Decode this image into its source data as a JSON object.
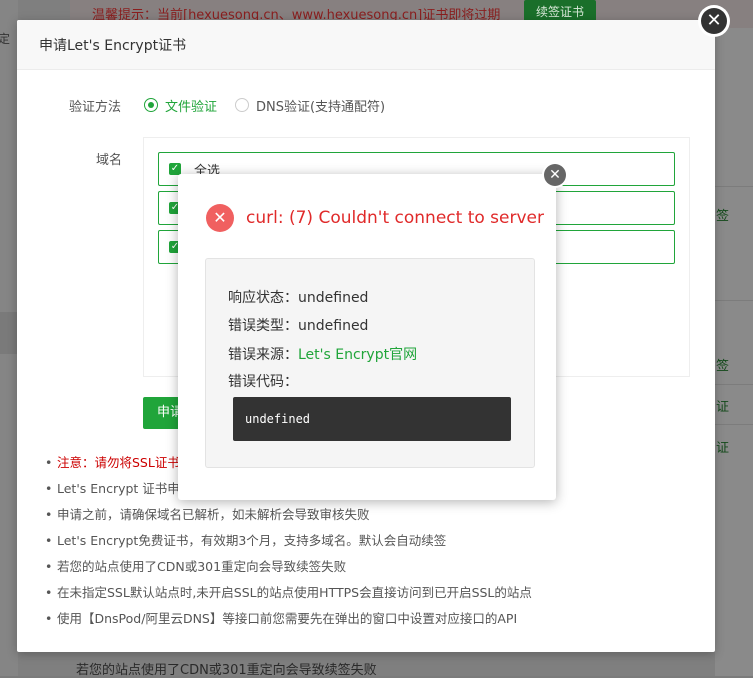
{
  "background": {
    "left_text": "定",
    "warning_text": "温馨提示：当前[hexuesong.cn、www.hexuesong.cn]证书即将过期",
    "renew_button": "续签证书",
    "right_items": [
      "签",
      "签",
      "证",
      "证"
    ],
    "bottom_note": "若您的站点使用了CDN或301重定向会导致续签失败"
  },
  "dialog": {
    "title": "申请Let's Encrypt证书",
    "verify_label": "验证方法",
    "verify_options": [
      {
        "label": "文件验证",
        "selected": true
      },
      {
        "label": "DNS验证(支持通配符)",
        "selected": false
      }
    ],
    "domain_label": "域名",
    "domain_rows": [
      "全选",
      "",
      ""
    ],
    "apply_button": "申请",
    "notes": [
      "注意：请勿将SSL证书",
      "Let's Encrypt 证书申",
      "申请之前，请确保域名已解析，如未解析会导致审核失败",
      "Let's Encrypt免费证书，有效期3个月，支持多域名。默认会自动续签",
      "若您的站点使用了CDN或301重定向会导致续签失败",
      "在未指定SSL默认站点时,未开启SSL的站点使用HTTPS会直接访问到已开启SSL的站点",
      "使用【DnsPod/阿里云DNS】等接口前您需要先在弹出的窗口中设置对应接口的API"
    ]
  },
  "error_popup": {
    "title": "curl: (7) Couldn't connect to server",
    "status_label": "响应状态：",
    "status_value": "undefined",
    "type_label": "错误类型：",
    "type_value": "undefined",
    "source_label": "错误来源：",
    "source_value": "Let's Encrypt官网",
    "code_label": "错误代码：",
    "code_value": "undefined"
  },
  "colors": {
    "accent": "#20a53a",
    "error": "#e02a2a"
  }
}
